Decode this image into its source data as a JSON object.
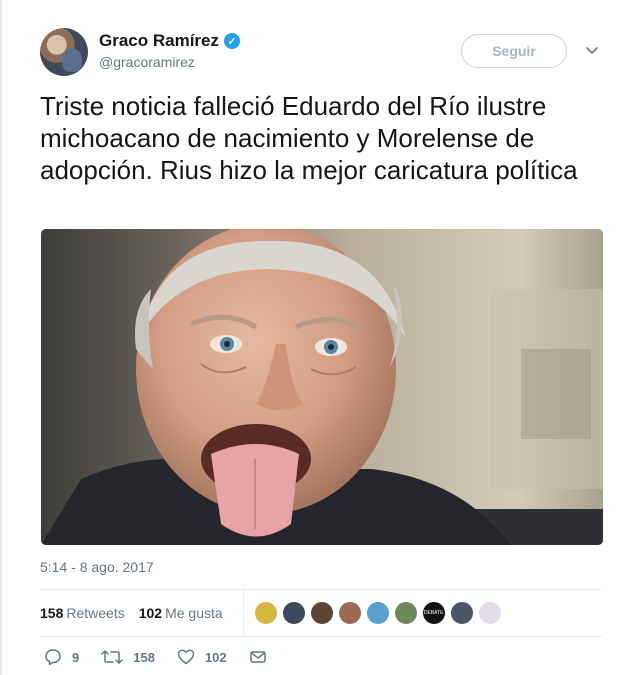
{
  "user": {
    "name": "Graco Ramírez",
    "handle": "@gracoramirez",
    "verified_icon": "check-badge-icon"
  },
  "follow_button": {
    "label": "Seguir"
  },
  "tweet": {
    "text": "Triste noticia falleció Eduardo del Río ilustre michoacano de nacimiento y Morelense de adopción. Rius hizo la mejor caricatura política",
    "timestamp": "5:14 - 8 ago. 2017"
  },
  "stats": {
    "retweets_count": "158",
    "retweets_label": "Retweets",
    "likes_count": "102",
    "likes_label": "Me gusta"
  },
  "likers": [
    {
      "color": "#d8b640"
    },
    {
      "color": "#3d4a5c"
    },
    {
      "color": "#5b4635"
    },
    {
      "color": "#9a6a52"
    },
    {
      "color": "#5aa0cf"
    },
    {
      "color": "#6e8a5a"
    },
    {
      "color": "#111111",
      "text": "DEBATE"
    },
    {
      "color": "#4c5666"
    },
    {
      "color": "#e4dbe9"
    }
  ],
  "actions": {
    "reply_count": "9",
    "retweet_count": "158",
    "like_count": "102"
  },
  "colors": {
    "accent": "#1da1f2",
    "text": "#14171a",
    "secondary": "#657786",
    "border": "#e6ecf0"
  }
}
